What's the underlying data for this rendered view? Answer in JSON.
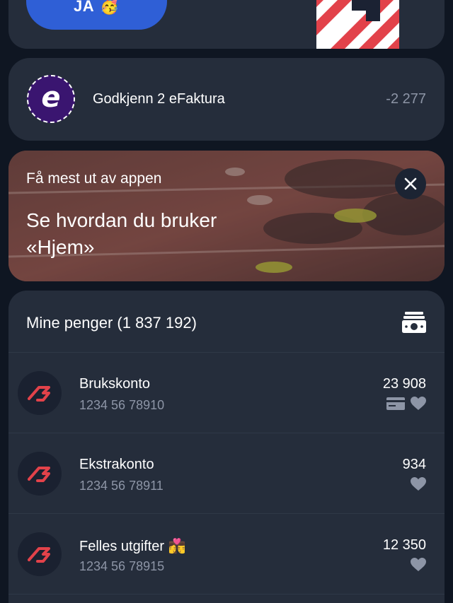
{
  "top_card": {
    "confirm_label": "JA",
    "confirm_emoji": "🥳"
  },
  "efaktura": {
    "icon_letter": "e",
    "label": "Godkjenn 2 eFaktura",
    "amount": "-2 277"
  },
  "promo": {
    "kicker": "Få mest ut av appen",
    "title": "Se hvordan du bruker «Hjem»"
  },
  "money": {
    "title": "Mine penger (1 837 192)",
    "accounts": [
      {
        "name": "Brukskonto",
        "number": "1234 56 78910",
        "balance": "23 908",
        "icons": [
          "card-icon",
          "heart-icon"
        ]
      },
      {
        "name": "Ekstrakonto",
        "number": "1234 56 78911",
        "balance": "934",
        "icons": [
          "heart-icon"
        ]
      },
      {
        "name": "Felles utgifter 👩‍❤️‍💋‍👨",
        "number": "1234 56 78915",
        "balance": "12 350",
        "icons": [
          "heart-icon"
        ]
      }
    ]
  },
  "colors": {
    "background": "#0f1622",
    "card": "#252d3b",
    "accent_blue": "#2f5fd6",
    "brand_red": "#e2424a",
    "efaktura_purple": "#3a1570",
    "muted_text": "#8d95a6"
  }
}
